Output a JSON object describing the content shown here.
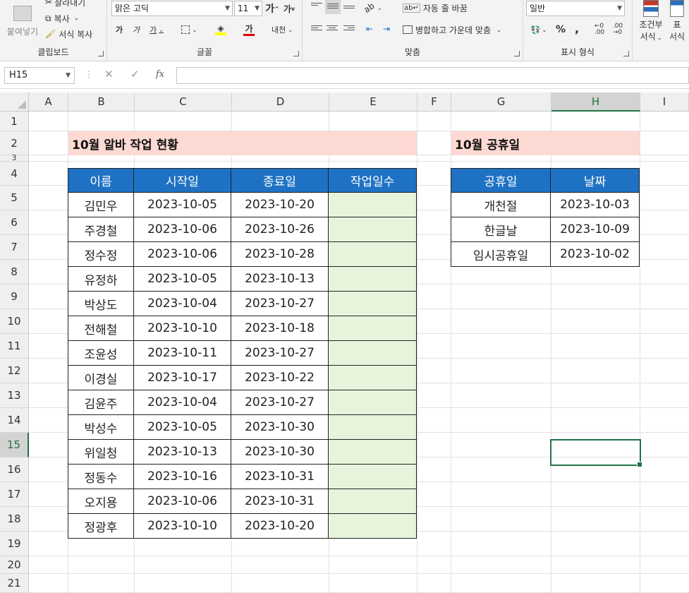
{
  "ribbon": {
    "clipboard": {
      "paste": "붙여넣기",
      "cut": "잘라내기",
      "copy": "복사",
      "format_painter": "서식 복사",
      "group": "클립보드"
    },
    "font": {
      "font_name": "맑은 고딕",
      "font_size": "11",
      "increase_size": "가",
      "decrease_size": "가",
      "bold": "가",
      "italic": "가",
      "underline": "가",
      "font_color_glyph": "가",
      "phonetic": "내천",
      "group": "글꼴"
    },
    "alignment": {
      "wrap_text": "자동 줄 바꿈",
      "merge_center": "병합하고 가운데 맞춤",
      "group": "맞춤"
    },
    "number": {
      "format": "일반",
      "percent": "%",
      "comma": ",",
      "group": "표시 형식"
    },
    "styles": {
      "conditional_l1": "조건부",
      "conditional_l2": "서식",
      "table_l1": "표",
      "table_l2": "서식"
    }
  },
  "formula_bar": {
    "name_box": "H15",
    "fx": "fx",
    "cancel": "✕",
    "enter": "✓",
    "content": ""
  },
  "columns": [
    "A",
    "B",
    "C",
    "D",
    "E",
    "F",
    "G",
    "H",
    "I"
  ],
  "selected_column": "H",
  "rows": [
    "1",
    "2",
    "3",
    "4",
    "5",
    "6",
    "7",
    "8",
    "9",
    "10",
    "11",
    "12",
    "13",
    "14",
    "15",
    "16",
    "17",
    "18",
    "19",
    "20",
    "21"
  ],
  "selected_row": "15",
  "work_table": {
    "title": "10월 알바 작업 현황",
    "headers": [
      "이름",
      "시작일",
      "종료일",
      "작업일수"
    ],
    "rows": [
      [
        "김민우",
        "2023-10-05",
        "2023-10-20",
        ""
      ],
      [
        "주경철",
        "2023-10-06",
        "2023-10-26",
        ""
      ],
      [
        "정수정",
        "2023-10-06",
        "2023-10-28",
        ""
      ],
      [
        "유정하",
        "2023-10-05",
        "2023-10-13",
        ""
      ],
      [
        "박상도",
        "2023-10-04",
        "2023-10-27",
        ""
      ],
      [
        "전해철",
        "2023-10-10",
        "2023-10-18",
        ""
      ],
      [
        "조윤성",
        "2023-10-11",
        "2023-10-27",
        ""
      ],
      [
        "이경실",
        "2023-10-17",
        "2023-10-22",
        ""
      ],
      [
        "김윤주",
        "2023-10-04",
        "2023-10-27",
        ""
      ],
      [
        "박성수",
        "2023-10-05",
        "2023-10-30",
        ""
      ],
      [
        "위일청",
        "2023-10-13",
        "2023-10-30",
        ""
      ],
      [
        "정동수",
        "2023-10-16",
        "2023-10-31",
        ""
      ],
      [
        "오지용",
        "2023-10-06",
        "2023-10-31",
        ""
      ],
      [
        "정광후",
        "2023-10-10",
        "2023-10-20",
        ""
      ]
    ]
  },
  "holiday_table": {
    "title": "10월 공휴일",
    "headers": [
      "공휴일",
      "날짜"
    ],
    "rows": [
      [
        "개천절",
        "2023-10-03"
      ],
      [
        "한글날",
        "2023-10-09"
      ],
      [
        "임시공휴일",
        "2023-10-02"
      ]
    ]
  },
  "colors": {
    "header_blue": "#1f72c3",
    "title_pink": "#fcd9d2",
    "input_green": "#e7f4dc",
    "excel_green": "#217346"
  }
}
